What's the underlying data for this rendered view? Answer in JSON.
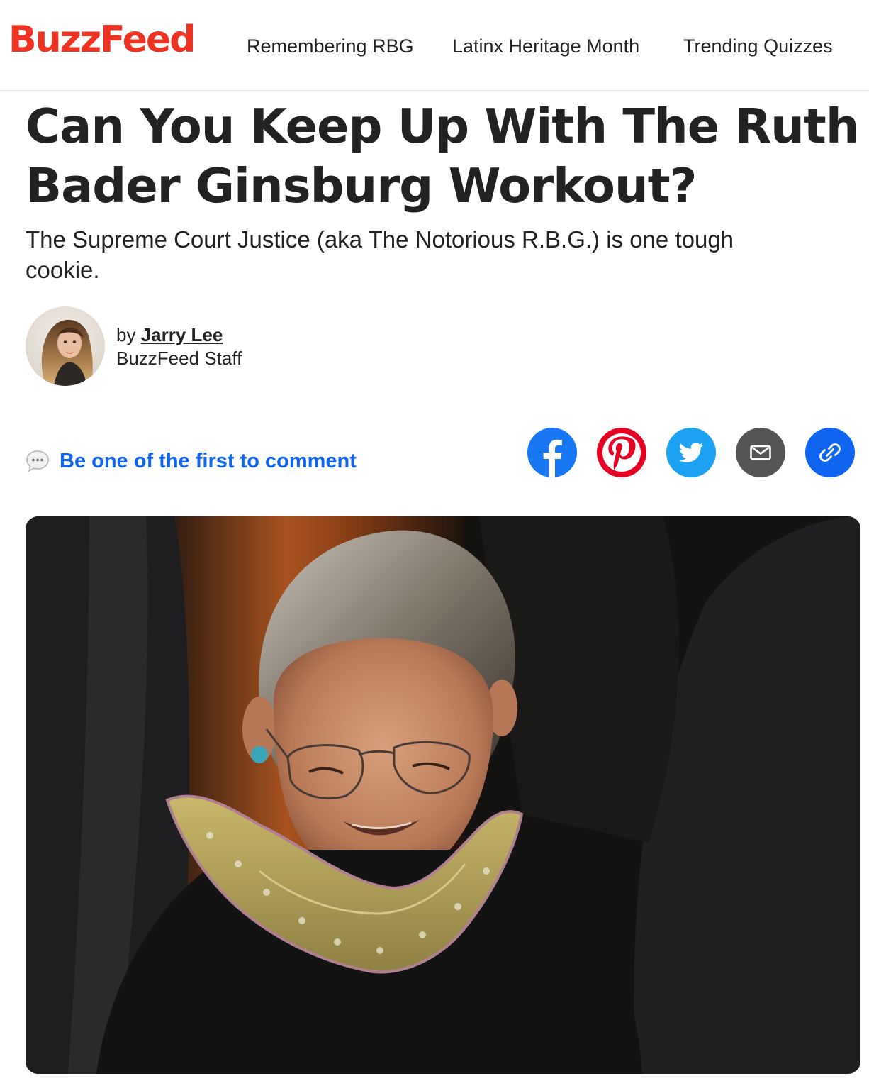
{
  "header": {
    "logo": "BuzzFeed",
    "nav": [
      {
        "label": "Remembering RBG"
      },
      {
        "label": "Latinx Heritage Month"
      },
      {
        "label": "Trending Quizzes"
      }
    ]
  },
  "article": {
    "title": "Can You Keep Up With The Ruth Bader Ginsburg Workout?",
    "description": "The Supreme Court Justice (aka The Notorious R.B.G.) is one tough cookie."
  },
  "byline": {
    "prefix": "by",
    "author": "Jarry Lee",
    "role": "BuzzFeed Staff"
  },
  "comments": {
    "label": "Be one of the first to comment"
  },
  "share": [
    {
      "icon": "facebook-icon",
      "color": "#1877f2"
    },
    {
      "icon": "pinterest-icon",
      "color": "#e60023"
    },
    {
      "icon": "twitter-icon",
      "color": "#1da1f2"
    },
    {
      "icon": "email-icon",
      "color": "#555555"
    },
    {
      "icon": "link-icon",
      "color": "#0f65ef"
    }
  ],
  "colors": {
    "brand_red": "#ee3322",
    "link_blue": "#0f65ef",
    "text": "#222222"
  }
}
